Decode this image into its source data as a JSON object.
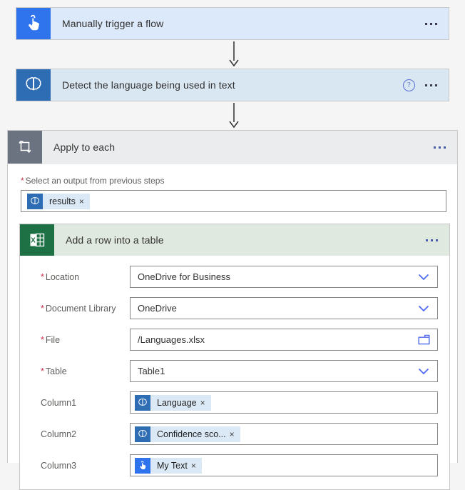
{
  "flow": {
    "trigger": {
      "title": "Manually trigger a flow",
      "icon": "touch-pointer-icon",
      "icon_color": "#2f73ed",
      "card_color": "#dce9fa",
      "menu_label": "…"
    },
    "detect_action": {
      "title": "Detect the language being used in text",
      "icon": "brain-icon",
      "icon_color": "#2e6db4",
      "card_color": "#d9e7f3",
      "help_label": "?",
      "menu_label": "…"
    },
    "loop": {
      "title": "Apply to each",
      "icon": "loop-icon",
      "icon_color": "#6c7380",
      "card_color": "#ebecee",
      "output_field": {
        "required": true,
        "label": "Select an output from previous steps",
        "token": {
          "text": "results",
          "icon": "brain-icon",
          "remove_label": "×"
        }
      }
    },
    "excel_action": {
      "title": "Add a row into a table",
      "icon": "excel-icon",
      "icon_color": "#1e7145",
      "card_color": "#dfe9e0",
      "menu_label": "…",
      "fields": [
        {
          "label": "Location",
          "required": true,
          "type": "dropdown",
          "value": "OneDrive for Business"
        },
        {
          "label": "Document Library",
          "required": true,
          "type": "dropdown",
          "value": "OneDrive"
        },
        {
          "label": "File",
          "required": true,
          "type": "filepicker",
          "value": "/Languages.xlsx"
        },
        {
          "label": "Table",
          "required": true,
          "type": "dropdown",
          "value": "Table1"
        },
        {
          "label": "Column1",
          "required": false,
          "type": "token",
          "token": {
            "text": "Language",
            "icon": "brain-icon",
            "remove_label": "×"
          }
        },
        {
          "label": "Column2",
          "required": false,
          "type": "token",
          "token": {
            "text": "Confidence sco...",
            "icon": "brain-icon",
            "remove_label": "×"
          }
        },
        {
          "label": "Column3",
          "required": false,
          "type": "token",
          "token": {
            "text": "My Text",
            "icon": "touch-pointer-icon",
            "remove_label": "×"
          }
        }
      ]
    }
  },
  "symbols": {
    "required_marker": "*"
  }
}
